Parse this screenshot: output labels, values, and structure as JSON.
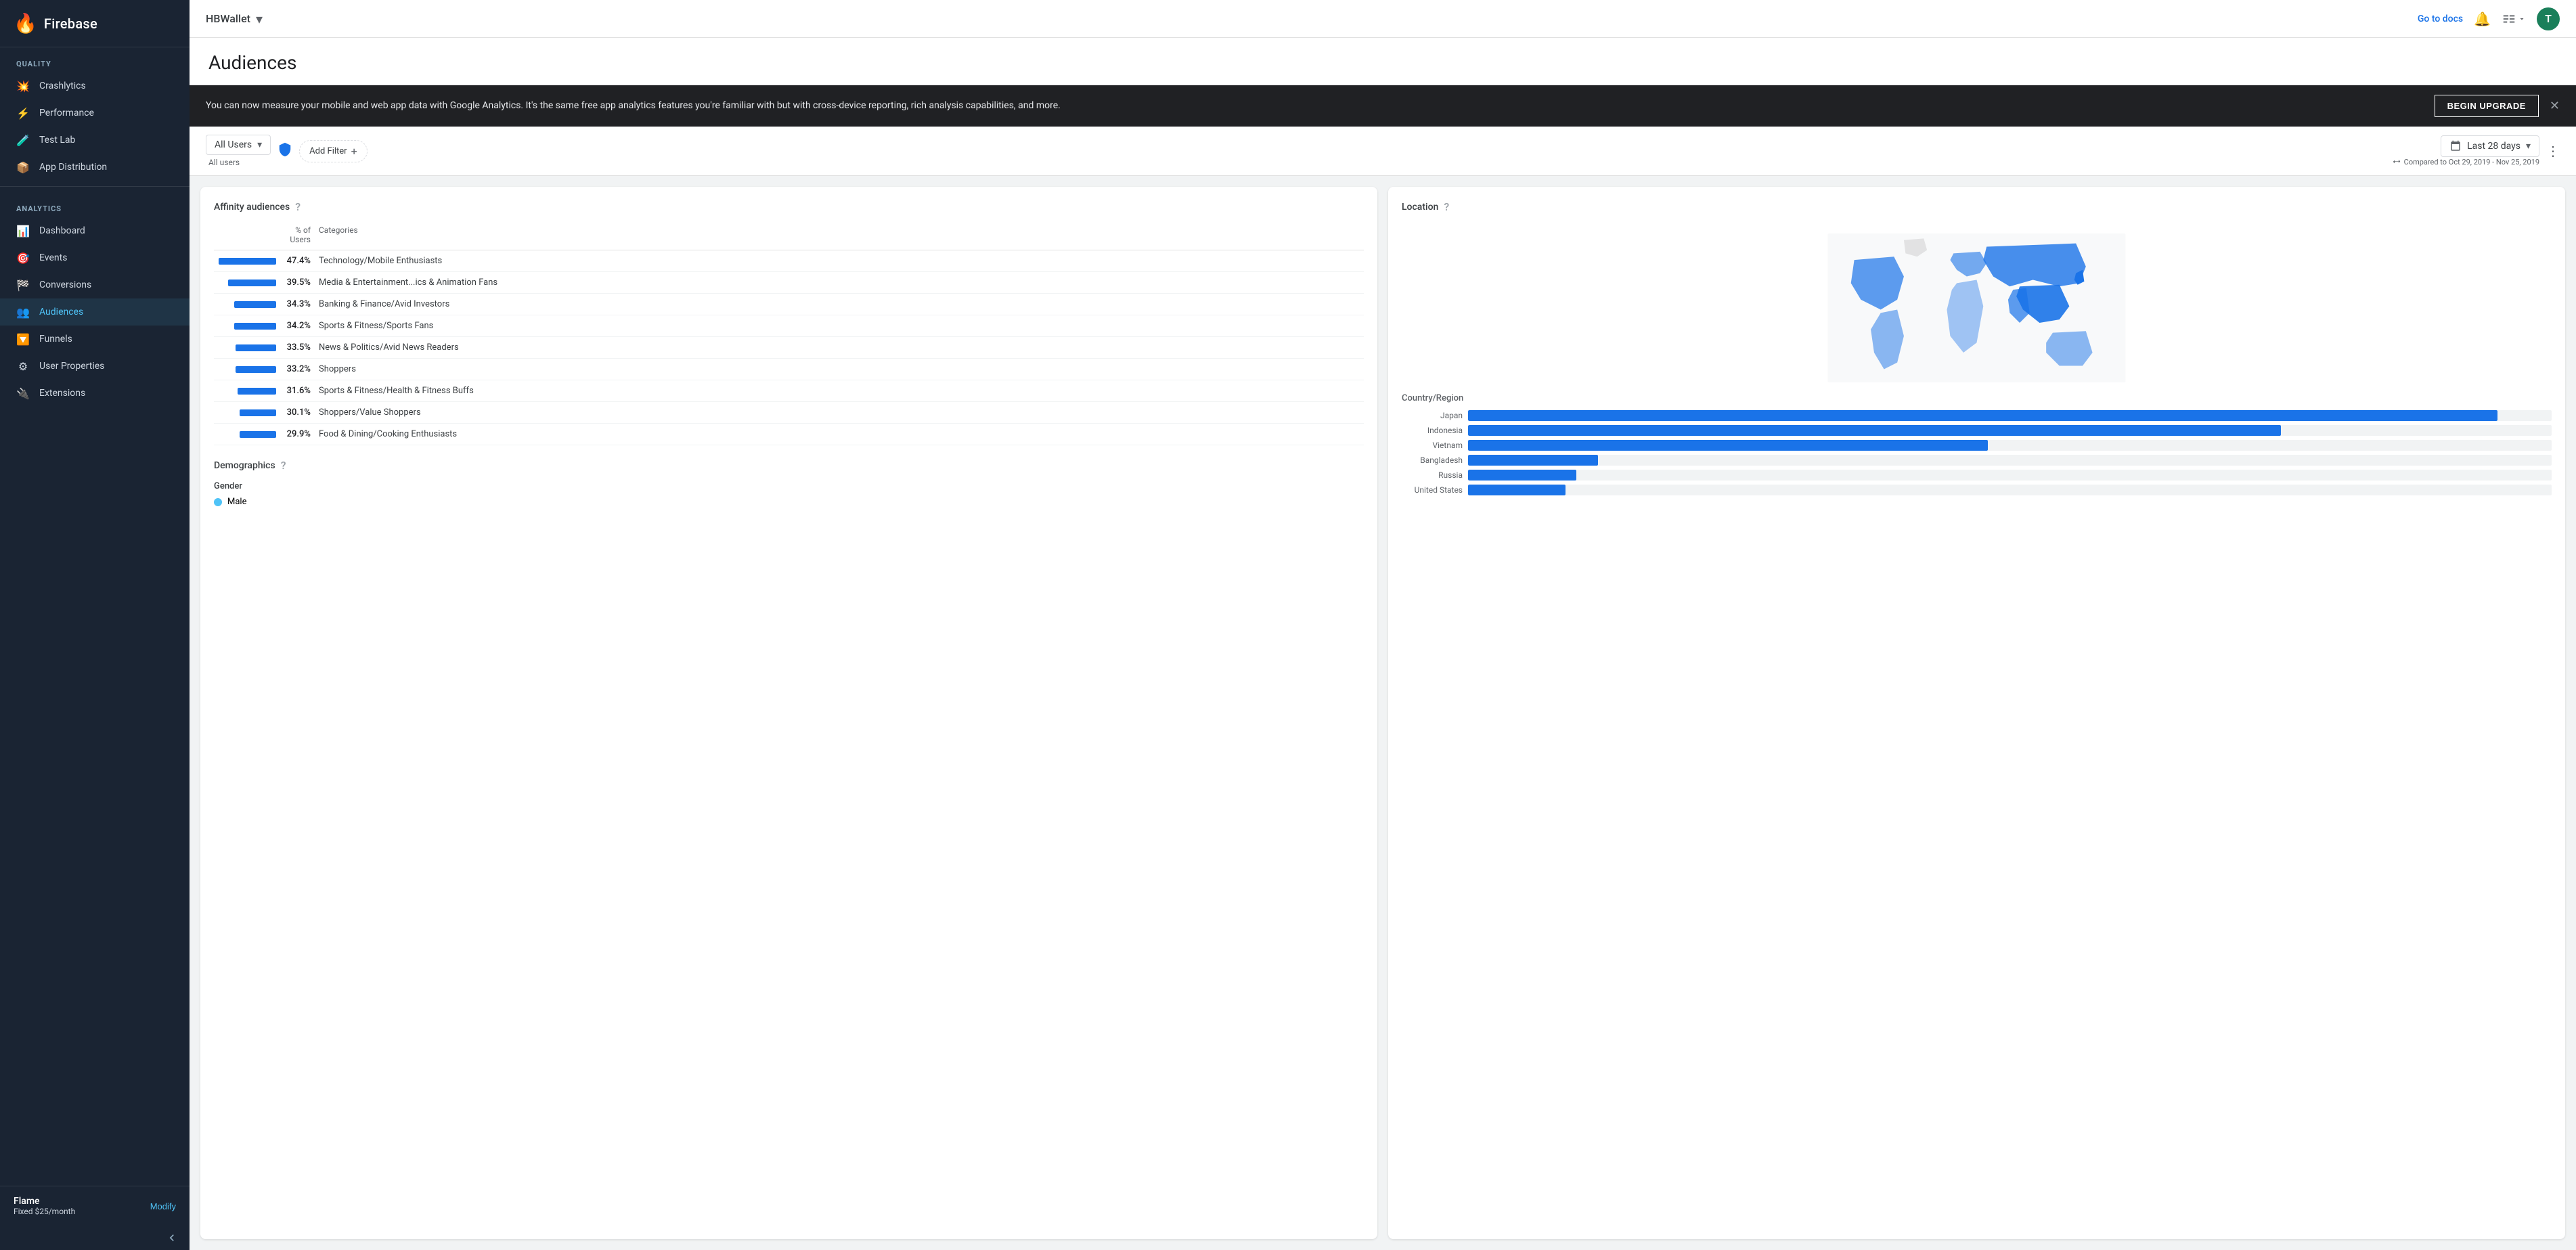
{
  "app": {
    "logo_text": "🔥",
    "brand": "Firebase",
    "project": "HBWallet",
    "avatar_letter": "T",
    "go_to_docs": "Go to docs"
  },
  "sidebar": {
    "quality_label": "Quality",
    "analytics_label": "Analytics",
    "items_quality": [
      {
        "id": "crashlytics",
        "label": "Crashlytics",
        "icon": "💥"
      },
      {
        "id": "performance",
        "label": "Performance",
        "icon": "⚡"
      },
      {
        "id": "test-lab",
        "label": "Test Lab",
        "icon": "🧪"
      },
      {
        "id": "app-distribution",
        "label": "App Distribution",
        "icon": "📦"
      }
    ],
    "items_analytics": [
      {
        "id": "dashboard",
        "label": "Dashboard",
        "icon": "📊"
      },
      {
        "id": "events",
        "label": "Events",
        "icon": "🎯"
      },
      {
        "id": "conversions",
        "label": "Conversions",
        "icon": "🏁"
      },
      {
        "id": "audiences",
        "label": "Audiences",
        "icon": "👥",
        "active": true
      },
      {
        "id": "funnels",
        "label": "Funnels",
        "icon": "🔽"
      },
      {
        "id": "user-properties",
        "label": "User Properties",
        "icon": "⚙"
      },
      {
        "id": "extensions",
        "label": "Extensions",
        "icon": "🔌"
      }
    ],
    "footer": {
      "flame_title": "Flame",
      "flame_sub": "Fixed $25/month",
      "modify_label": "Modify"
    }
  },
  "page": {
    "title": "Audiences"
  },
  "banner": {
    "text": "You can now measure your mobile and web app data with Google Analytics. It's the same free app analytics features you're familiar with but with cross-device reporting, rich analysis capabilities, and more.",
    "upgrade_btn": "BEGIN UPGRADE"
  },
  "toolbar": {
    "audience_selector": "All Users",
    "all_users_sublabel": "All users",
    "add_filter_label": "Add Filter",
    "date_range": "Last 28 days",
    "compare_text": "Compared to Oct 29, 2019 - Nov 25, 2019"
  },
  "affinity": {
    "title": "Affinity audiences",
    "col_pct": "% of Users",
    "col_cat": "Categories",
    "rows": [
      {
        "pct": "47.4%",
        "category": "Technology/Mobile Enthusiasts",
        "bar_pct": 47.4
      },
      {
        "pct": "39.5%",
        "category": "Media & Entertainment...ics & Animation Fans",
        "bar_pct": 39.5
      },
      {
        "pct": "34.3%",
        "category": "Banking & Finance/Avid Investors",
        "bar_pct": 34.3
      },
      {
        "pct": "34.2%",
        "category": "Sports & Fitness/Sports Fans",
        "bar_pct": 34.2
      },
      {
        "pct": "33.5%",
        "category": "News & Politics/Avid News Readers",
        "bar_pct": 33.5
      },
      {
        "pct": "33.2%",
        "category": "Shoppers",
        "bar_pct": 33.2
      },
      {
        "pct": "31.6%",
        "category": "Sports & Fitness/Health & Fitness Buffs",
        "bar_pct": 31.6
      },
      {
        "pct": "30.1%",
        "category": "Shoppers/Value Shoppers",
        "bar_pct": 30.1
      },
      {
        "pct": "29.9%",
        "category": "Food & Dining/Cooking Enthusiasts",
        "bar_pct": 29.9
      }
    ]
  },
  "demographics": {
    "title": "Demographics",
    "gender_label": "Gender",
    "male_label": "Male"
  },
  "location": {
    "title": "Location",
    "country_region_label": "Country/Region",
    "countries": [
      {
        "name": "Japan",
        "bar_pct": 95
      },
      {
        "name": "Indonesia",
        "bar_pct": 75
      },
      {
        "name": "Vietnam",
        "bar_pct": 48
      },
      {
        "name": "Bangladesh",
        "bar_pct": 12
      },
      {
        "name": "Russia",
        "bar_pct": 10
      },
      {
        "name": "United States",
        "bar_pct": 9
      }
    ]
  }
}
